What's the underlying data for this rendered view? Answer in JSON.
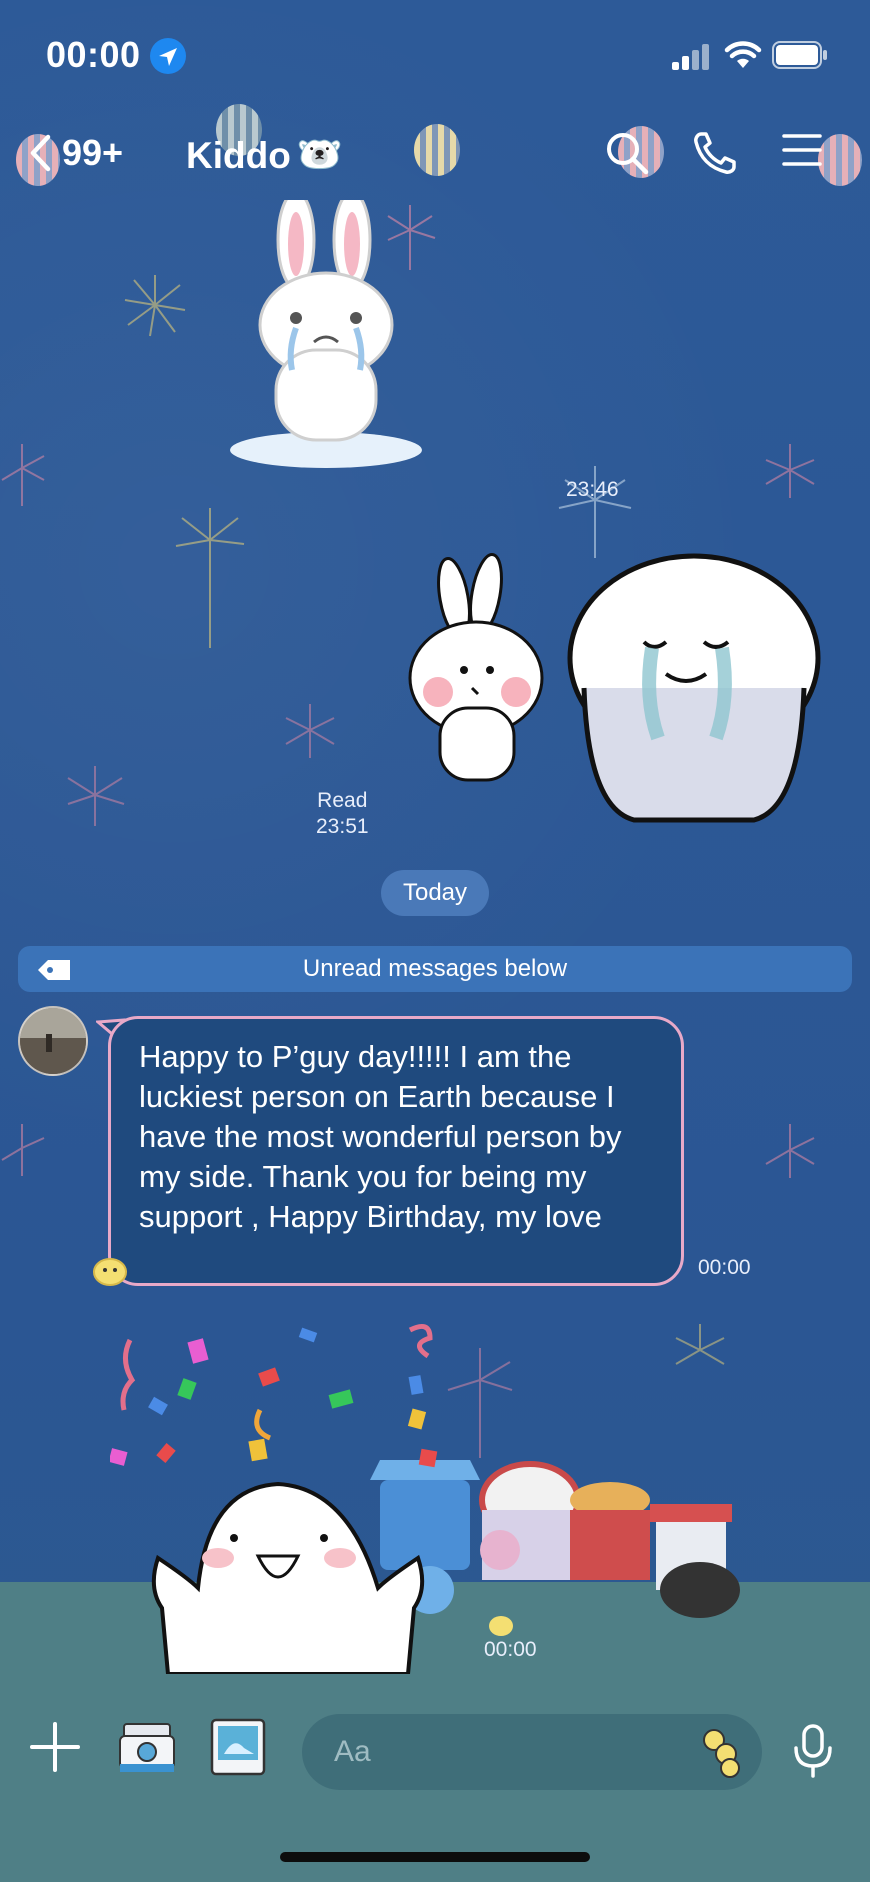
{
  "status_bar": {
    "time": "00:00",
    "icons": [
      "location-arrow-icon",
      "cellular-signal-icon",
      "wifi-icon",
      "battery-icon"
    ]
  },
  "nav": {
    "back_count": "99+",
    "title": "Kiddo",
    "title_emoji": "🐻‍❄️",
    "icons": [
      "chevron-left-icon",
      "search-icon",
      "phone-icon",
      "menu-icon"
    ]
  },
  "messages": {
    "sticker1_time": "23:46",
    "sticker2_read": "Read",
    "sticker2_time": "23:51",
    "date_divider": "Today",
    "unread_notice": "Unread messages below",
    "incoming_text": "Happy to P’guy day!!!!! I am the luckiest person on Earth because I have the most wonderful person by my side. Thank you for being my support , Happy Birthday, my love",
    "incoming_time": "00:00",
    "sticker3_time": "00:00"
  },
  "input": {
    "placeholder": "Aa"
  },
  "colors": {
    "background": "#2c5794",
    "bubble": "#1f4a7e",
    "bubble_border": "#e8a9c8",
    "unread_bar": "#3b73b8",
    "ground": "#4f7f86"
  }
}
